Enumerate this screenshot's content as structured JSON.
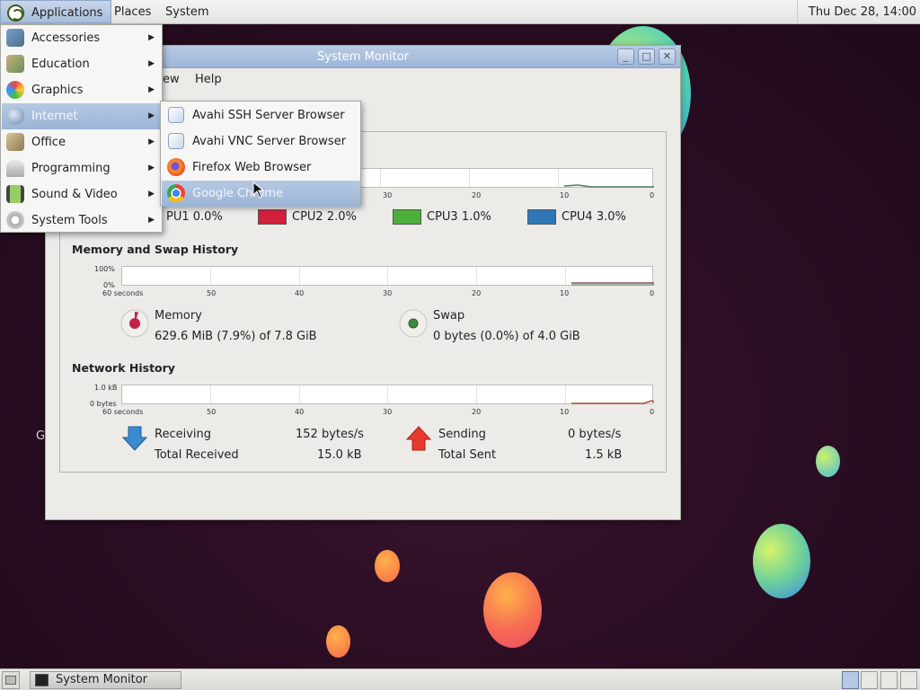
{
  "top_panel": {
    "applications": "Applications",
    "places": "Places",
    "system": "System",
    "clock": "Thu Dec 28, 14:00"
  },
  "window": {
    "title": "System Monitor",
    "menu_view": "ew",
    "menu_help": "Help",
    "cpu": {
      "labels": [
        "PU1",
        "CPU2",
        "CPU3",
        "CPU4"
      ],
      "values": [
        "0.0%",
        "2.0%",
        "1.0%",
        "3.0%"
      ],
      "colors": [
        "#e86d1c",
        "#d21f3c",
        "#4caf3a",
        "#2f78b5"
      ]
    },
    "x_ticks": [
      "60 seconds",
      "50",
      "40",
      "30",
      "20",
      "10",
      "0"
    ],
    "cpu_ticks": [
      "30",
      "20",
      "10",
      "0"
    ],
    "memory": {
      "title": "Memory and Swap History",
      "y_top": "100%",
      "y_bottom": "0%",
      "mem_label": "Memory",
      "mem_value": "629.6 MiB (7.9%) of 7.8 GiB",
      "swap_label": "Swap",
      "swap_value": "0 bytes (0.0%) of 4.0 GiB"
    },
    "network": {
      "title": "Network History",
      "y_top": "1.0 kB",
      "y_bottom": "0 bytes",
      "receiving_label": "Receiving",
      "receiving_rate": "152 bytes/s",
      "total_received_label": "Total Received",
      "total_received": "15.0 kB",
      "sending_label": "Sending",
      "sending_rate": "0 bytes/s",
      "total_sent_label": "Total Sent",
      "total_sent": "1.5 kB"
    }
  },
  "apps_menu": {
    "items": [
      {
        "label": "Accessories",
        "icon": "accessories-icon"
      },
      {
        "label": "Education",
        "icon": "education-icon"
      },
      {
        "label": "Graphics",
        "icon": "graphics-icon"
      },
      {
        "label": "Internet",
        "icon": "internet-icon"
      },
      {
        "label": "Office",
        "icon": "office-icon"
      },
      {
        "label": "Programming",
        "icon": "programming-icon"
      },
      {
        "label": "Sound & Video",
        "icon": "sound-video-icon"
      },
      {
        "label": "System Tools",
        "icon": "system-tools-icon"
      }
    ]
  },
  "internet_menu": {
    "items": [
      {
        "label": "Avahi SSH Server Browser",
        "icon": "avahi-ssh-icon"
      },
      {
        "label": "Avahi VNC Server Browser",
        "icon": "avahi-vnc-icon"
      },
      {
        "label": "Firefox Web Browser",
        "icon": "firefox-icon"
      },
      {
        "label": "Google Chrome",
        "icon": "chrome-icon"
      }
    ]
  },
  "desktop": {
    "partial_label": "G"
  },
  "bottom_panel": {
    "task": "System Monitor"
  }
}
